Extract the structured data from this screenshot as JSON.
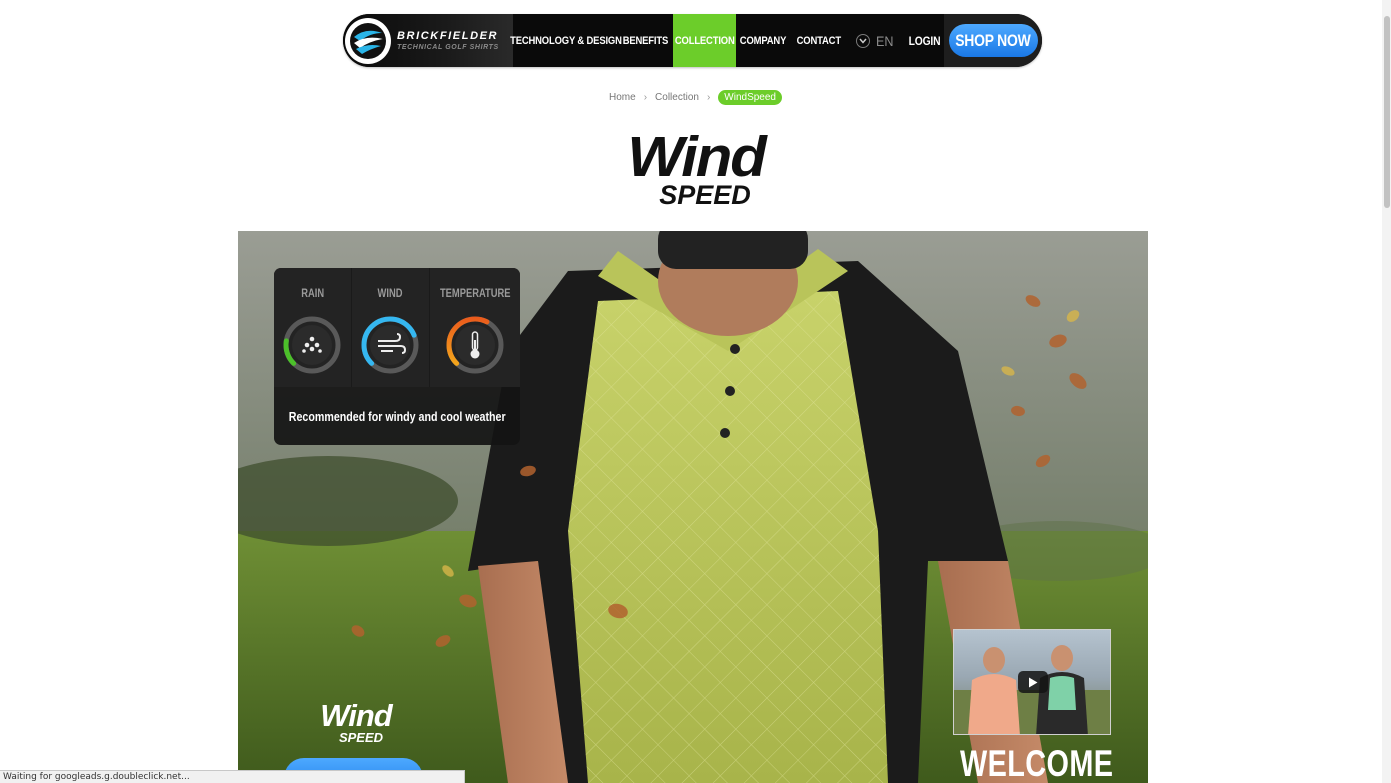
{
  "nav": {
    "brand_name": "BRICKFIELDER",
    "brand_tagline": "TECHNICAL GOLF SHIRTS",
    "items": [
      {
        "label": "TECHNOLOGY & DESIGN"
      },
      {
        "label": "BENEFITS"
      },
      {
        "label": "COLLECTION",
        "active": true
      },
      {
        "label": "COMPANY"
      },
      {
        "label": "CONTACT"
      }
    ],
    "language": "EN",
    "login_label": "LOGIN",
    "shop_label": "SHOP NOW",
    "active_color": "#6ccd2a",
    "shop_color": "#1a78e6"
  },
  "breadcrumb": {
    "items": [
      "Home",
      "Collection"
    ],
    "current": "WindSpeed"
  },
  "title": {
    "line1": "Wind",
    "line2": "SPEED"
  },
  "weather": {
    "labels": {
      "rain": "RAIN",
      "wind": "WIND",
      "temperature": "TEMPERATURE"
    },
    "icons": {
      "rain": "rain-drops-icon",
      "wind": "wind-icon",
      "temperature": "thermometer-icon"
    },
    "levels": {
      "rain": 0.2,
      "wind": 0.75,
      "temperature": 0.6
    },
    "caption": "Recommended for windy and cool weather",
    "colors": {
      "rain": "#4cc02a",
      "wind": "#35b7f0",
      "temperature": "#f2a51c"
    }
  },
  "hero": {
    "mini_logo_line1": "Wind",
    "mini_logo_line2": "SPEED",
    "video_caption": "WELCOME"
  },
  "status_bar": {
    "text": "Waiting for googleads.g.doubleclick.net..."
  }
}
